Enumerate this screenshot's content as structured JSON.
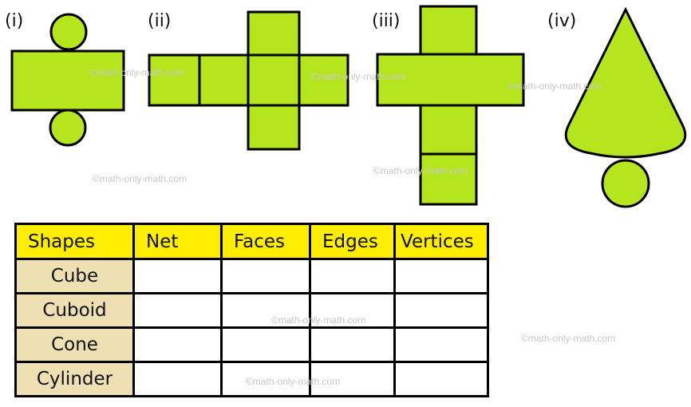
{
  "nets": [
    {
      "label": "(i)",
      "shape": "cylinder-net"
    },
    {
      "label": "(ii)",
      "shape": "cube-net"
    },
    {
      "label": "(iii)",
      "shape": "cuboid-net"
    },
    {
      "label": "(iv)",
      "shape": "cone-net"
    }
  ],
  "colors": {
    "fill": "#b5e61d",
    "stroke": "#000000",
    "header": "#ffee00",
    "shape_cell": "#efe0b3"
  },
  "table": {
    "headers": [
      "Shapes",
      "Net",
      "Faces",
      "Edges",
      "Vertices"
    ],
    "rows": [
      {
        "shape": "Cube",
        "net": "",
        "faces": "",
        "edges": "",
        "vertices": ""
      },
      {
        "shape": "Cuboid",
        "net": "",
        "faces": "",
        "edges": "",
        "vertices": ""
      },
      {
        "shape": "Cone",
        "net": "",
        "faces": "",
        "edges": "",
        "vertices": ""
      },
      {
        "shape": "Cylinder",
        "net": "",
        "faces": "",
        "edges": "",
        "vertices": ""
      }
    ]
  },
  "watermark": "©math-only-math.com"
}
